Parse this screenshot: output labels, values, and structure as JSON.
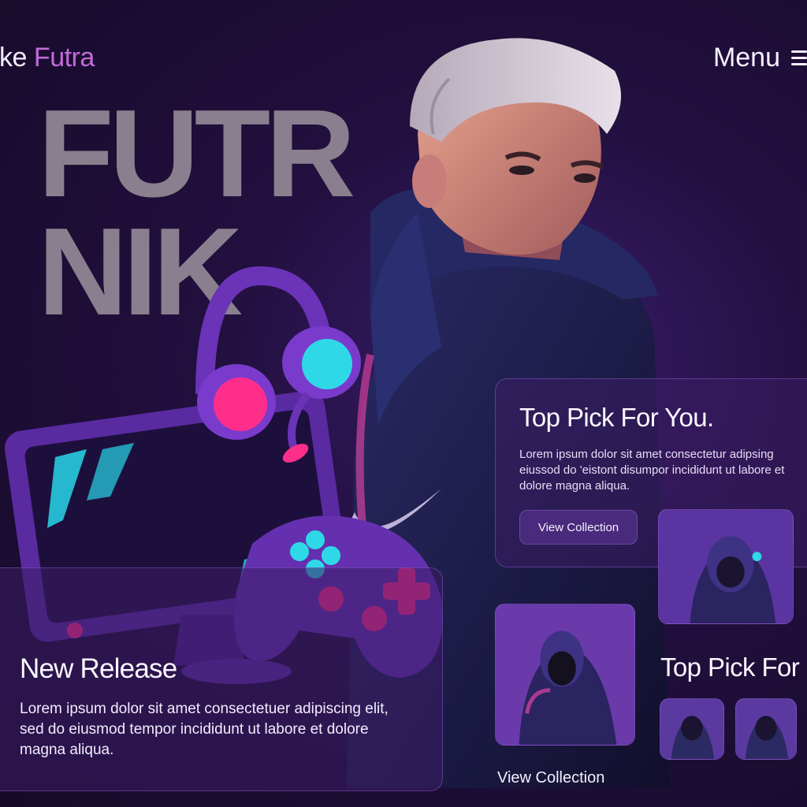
{
  "brand": {
    "part1": "ike",
    "part2": "Futra"
  },
  "header": {
    "menu_label": "Menu"
  },
  "hero": {
    "line1": "FUTR",
    "line2": "NIK"
  },
  "top_pick_card": {
    "title": "Top Pick For You.",
    "body": "Lorem ipsum dolor sit amet consectetur adipsing eiussod do 'eistont disumpor incididunt ut labore et dolore magna aliqua.",
    "button_label": "View Collection"
  },
  "release_card": {
    "title": "New Release",
    "body": "Lorem ipsum dolor sit amet consectetuer adipiscing elit, sed do eiusmod tempor incididunt ut labore et dolore magna aliqua."
  },
  "secondary": {
    "title": "Top Pick For",
    "link_label": "View Collection"
  },
  "colors": {
    "background": "#1a0d2e",
    "accent_purple": "#c06bd9",
    "accent_pink": "#ff2e8a",
    "accent_cyan": "#2fd8e6"
  },
  "icons": [
    "hamburger-menu-icon",
    "swoosh-logo-icon"
  ]
}
